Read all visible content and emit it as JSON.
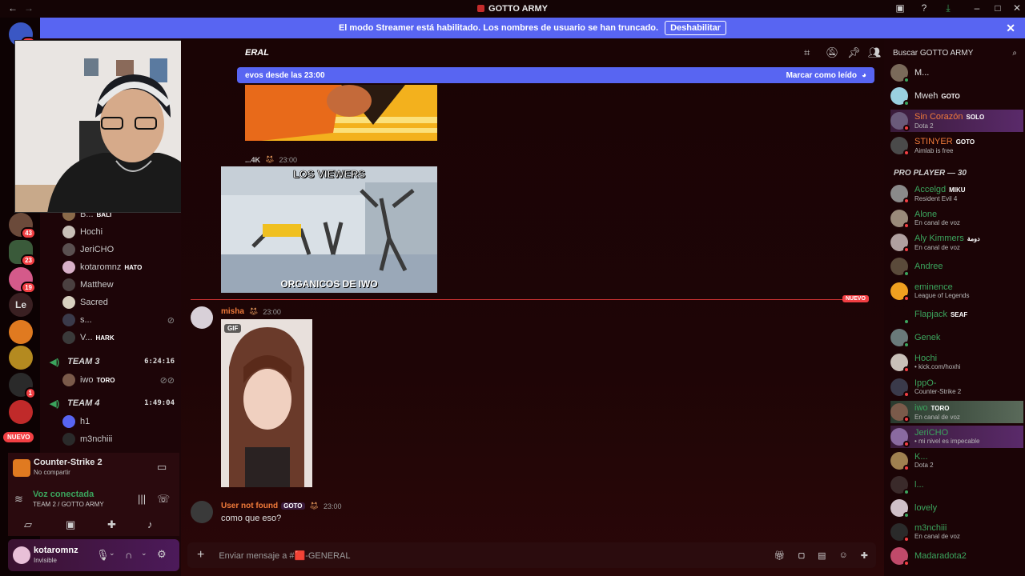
{
  "window": {
    "title": "GOTTO ARMY"
  },
  "banner": {
    "text": "El modo Streamer está habilitado. Los nombres de usuario se han truncado.",
    "button": "Deshabilitar"
  },
  "rail": {
    "badges": [
      "76",
      "43",
      "23",
      "19",
      "1"
    ],
    "text_server": "Le",
    "new_label": "NUEVO"
  },
  "channel": {
    "name_partial": "ERAL",
    "new_messages": "evos desde las 23:00",
    "mark_read": "Marcar como leído",
    "input_placeholder": "Enviar mensaje a #🟥-GENERAL"
  },
  "voice_members": [
    {
      "name": "B...",
      "tag": "BALI"
    },
    {
      "name": "Hochi",
      "tag": ""
    },
    {
      "name": "JeriCHO",
      "tag": ""
    },
    {
      "name": "kotaromnz",
      "tag": "HATO"
    },
    {
      "name": "Matthew",
      "tag": ""
    },
    {
      "name": "Sacred",
      "tag": ""
    },
    {
      "name": "s...",
      "tag": ""
    },
    {
      "name": "V...",
      "tag": "HARK"
    }
  ],
  "teams": [
    {
      "name": "TEAM 3",
      "time": "6:24:16",
      "members": [
        {
          "name": "iwo",
          "tag": "TORO"
        }
      ]
    },
    {
      "name": "TEAM 4",
      "time": "1:49:04",
      "members": [
        {
          "name": "h1",
          "tag": ""
        },
        {
          "name": "m3nchiii",
          "tag": ""
        }
      ]
    }
  ],
  "activity": {
    "game": "Counter-Strike 2",
    "status": "No compartir"
  },
  "voice": {
    "title": "Voz conectada",
    "channel": "TEAM 2 / GOTTO ARMY"
  },
  "user": {
    "name": "kotaromnz",
    "status": "Invisible"
  },
  "messages": [
    {
      "author": "...4K",
      "time": "23:00",
      "meme_top": "LOS VIEWERS",
      "meme_bottom": "ORGANICOS DE IWO"
    },
    {
      "author": "misha",
      "time": "23:00",
      "gif_label": "GIF"
    },
    {
      "author": "User not found",
      "tag": "GOTO",
      "time": "23:00",
      "text": "como que eso?"
    }
  ],
  "new_divider": "NUEVO",
  "member_search": "Buscar GOTTO ARMY",
  "role_header": "PRO PLAYER — 30",
  "members_top": [
    {
      "name": "M...",
      "tag": "",
      "sub": ""
    },
    {
      "name": "Mweh",
      "tag": "GOTO",
      "sub": ""
    },
    {
      "name": "Sin Corazón",
      "tag": "SOLO",
      "sub": "Dota 2"
    },
    {
      "name": "STINYER",
      "tag": "GOTO",
      "sub": "Aimlab is free"
    }
  ],
  "members_pro": [
    {
      "name": "Accelgd",
      "tag": "MIKU",
      "sub": "Resident Evil 4"
    },
    {
      "name": "Alone",
      "tag": "",
      "sub": "En canal de voz"
    },
    {
      "name": "Aly Kimmers",
      "tag": "دومة",
      "sub": "En canal de voz"
    },
    {
      "name": "Andree",
      "tag": "",
      "sub": ""
    },
    {
      "name": "eminence",
      "tag": "",
      "sub": "League of Legends"
    },
    {
      "name": "Flapjack",
      "tag": "SEAF",
      "sub": ""
    },
    {
      "name": "Genek",
      "tag": "",
      "sub": ""
    },
    {
      "name": "Hochi",
      "tag": "",
      "sub": "• kick.com/hoxhi"
    },
    {
      "name": "IppO-",
      "tag": "",
      "sub": "Counter-Strike 2"
    },
    {
      "name": "iwo",
      "tag": "TORO",
      "sub": "En canal de voz"
    },
    {
      "name": "JeriCHO",
      "tag": "",
      "sub": "• mi nivel es impecable"
    },
    {
      "name": "K...",
      "tag": "",
      "sub": "Dota 2"
    },
    {
      "name": "l...",
      "tag": "",
      "sub": ""
    },
    {
      "name": "lovely",
      "tag": "",
      "sub": ""
    },
    {
      "name": "m3nchiii",
      "tag": "",
      "sub": "En canal de voz"
    },
    {
      "name": "Madaradota2",
      "tag": "",
      "sub": ""
    }
  ]
}
